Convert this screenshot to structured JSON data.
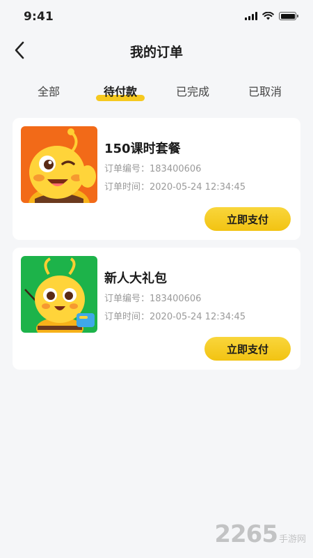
{
  "status_bar": {
    "time": "9:41"
  },
  "nav": {
    "title": "我的订单"
  },
  "tabs": [
    {
      "label": "全部"
    },
    {
      "label": "待付款"
    },
    {
      "label": "已完成"
    },
    {
      "label": "已取消"
    }
  ],
  "active_tab": "待付款",
  "orders": [
    {
      "name": "150课时套餐",
      "order_no_label": "订单编号：183400606",
      "order_time_label": "订单时间：2020-05-24 12:34:45",
      "pay_label": "立即支付",
      "thumb_color": "#f26a18"
    },
    {
      "name": "新人大礼包",
      "order_no_label": "订单编号：183400606",
      "order_time_label": "订单时间：2020-05-24 12:34:45",
      "pay_label": "立即支付",
      "thumb_color": "#1db34a"
    }
  ],
  "watermark": {
    "main": "2265",
    "sub": "手游网"
  },
  "colors": {
    "accent": "#f6c91f",
    "background": "#f5f6f8"
  }
}
